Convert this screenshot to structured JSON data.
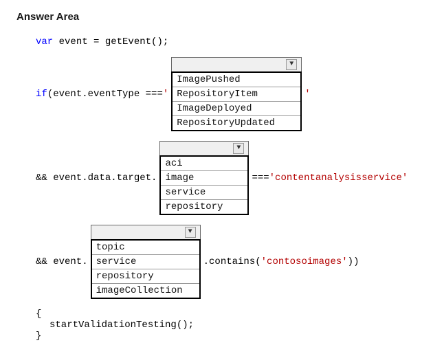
{
  "title": "Answer Area",
  "code": {
    "line1_kw": "var",
    "line1_rest": " event = getEvent();",
    "line2_kw": "if",
    "line2_rest": " (event.eventType === ",
    "quote": "'",
    "amp_target": "&& event.data.target.",
    "triple_eq": " === ",
    "str_service": "'contentanalysisservice'",
    "amp_event": "&& event.",
    "contains_pre": ".contains(",
    "str_images": "'contosoimages'",
    "contains_post": "))",
    "brace_open": "{",
    "start_call": "startValidationTesting();",
    "brace_close": "}"
  },
  "dropdown1": {
    "options": [
      "ImagePushed",
      "RepositoryItem",
      "ImageDeployed",
      "RepositoryUpdated"
    ]
  },
  "dropdown2": {
    "options": [
      "aci",
      "image",
      "service",
      "repository"
    ]
  },
  "dropdown3": {
    "options": [
      "topic",
      "service",
      "repository",
      "imageCollection"
    ]
  }
}
